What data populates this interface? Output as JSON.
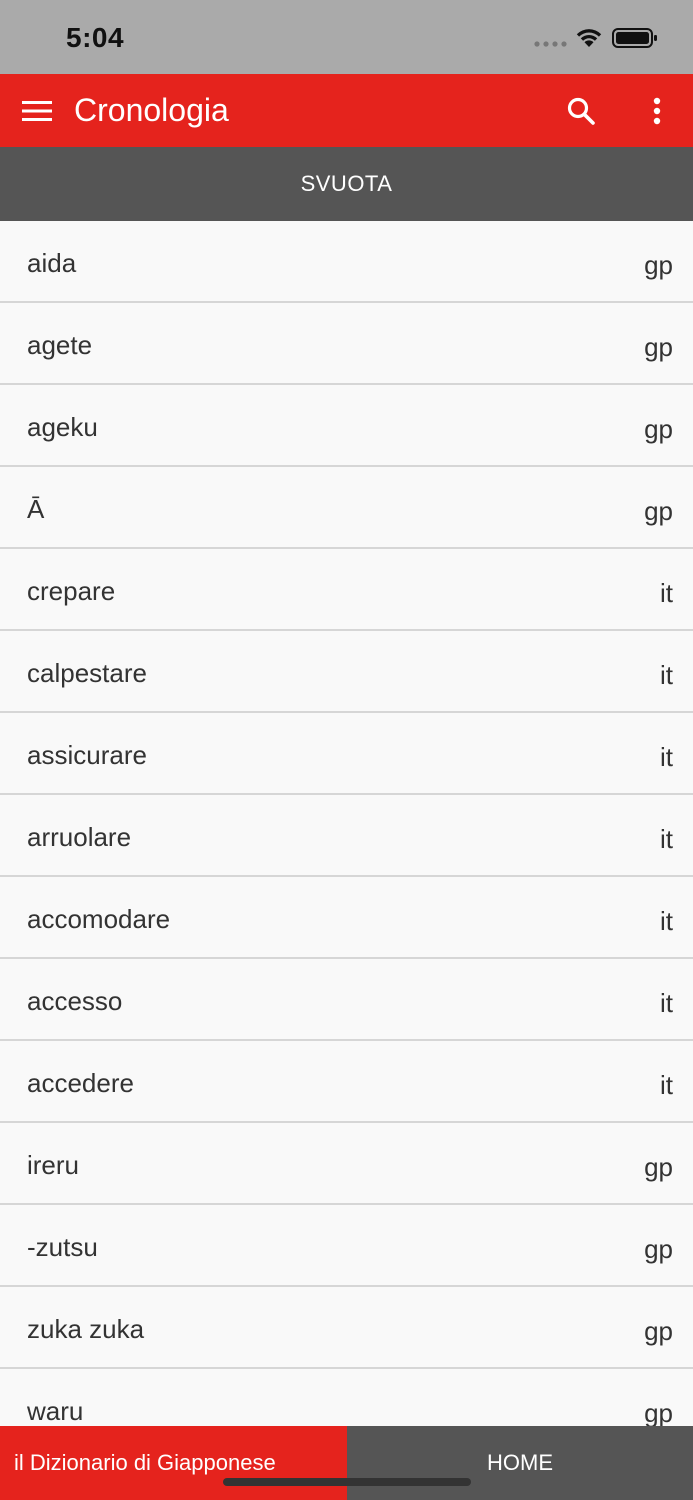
{
  "status_bar": {
    "time": "5:04"
  },
  "app_bar": {
    "title": "Cronologia",
    "background": "#e5231d",
    "icons": {
      "menu": "menu-icon",
      "search": "search-icon",
      "more": "more-vert-icon"
    }
  },
  "clear_button": {
    "label": "SVUOTA"
  },
  "history": [
    {
      "word": "aida",
      "lang": "gp"
    },
    {
      "word": "agete",
      "lang": "gp"
    },
    {
      "word": "ageku",
      "lang": "gp"
    },
    {
      "word": "Ā",
      "lang": "gp"
    },
    {
      "word": "crepare",
      "lang": "it"
    },
    {
      "word": "calpestare",
      "lang": "it"
    },
    {
      "word": "assicurare",
      "lang": "it"
    },
    {
      "word": "arruolare",
      "lang": "it"
    },
    {
      "word": "accomodare",
      "lang": "it"
    },
    {
      "word": "accesso",
      "lang": "it"
    },
    {
      "word": "accedere",
      "lang": "it"
    },
    {
      "word": "ireru",
      "lang": "gp"
    },
    {
      "word": "-zutsu",
      "lang": "gp"
    },
    {
      "word": "zuka zuka",
      "lang": "gp"
    },
    {
      "word": "waru",
      "lang": "gp"
    }
  ],
  "bottom_bar": {
    "left_label": "il Dizionario di Giapponese",
    "right_label": "HOME"
  }
}
